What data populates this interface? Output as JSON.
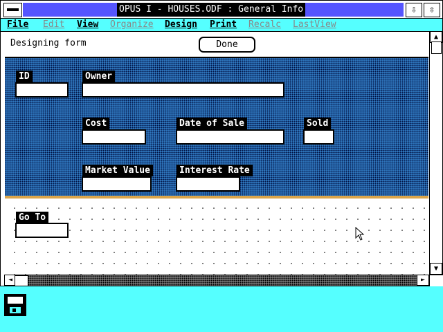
{
  "window": {
    "title": "OPUS I - HOUSES.ODF : General Info",
    "minimize_glyph": "⇩",
    "maximize_glyph": "⇳"
  },
  "menu": [
    {
      "label": "File",
      "enabled": true
    },
    {
      "label": "Edit",
      "enabled": false
    },
    {
      "label": "View",
      "enabled": true
    },
    {
      "label": "Organize",
      "enabled": false
    },
    {
      "label": "Design",
      "enabled": true
    },
    {
      "label": "Print",
      "enabled": true
    },
    {
      "label": "Recalc",
      "enabled": false
    },
    {
      "label": "LastView",
      "enabled": false
    }
  ],
  "status": {
    "text": "Designing form",
    "done_label": "Done"
  },
  "fields": {
    "id": "ID",
    "owner": "Owner",
    "cost": "Cost",
    "date_of_sale": "Date of Sale",
    "sold": "Sold",
    "market_value": "Market Value",
    "interest_rate": "Interest Rate",
    "go_to": "Go To"
  },
  "scroll": {
    "up": "▲",
    "down": "▼",
    "left": "◄",
    "right": "►"
  },
  "colors": {
    "header_band": "#3a8cd8",
    "divider": "#dba54a",
    "desktop": "#55ffff",
    "title_active": "#5555ff"
  }
}
